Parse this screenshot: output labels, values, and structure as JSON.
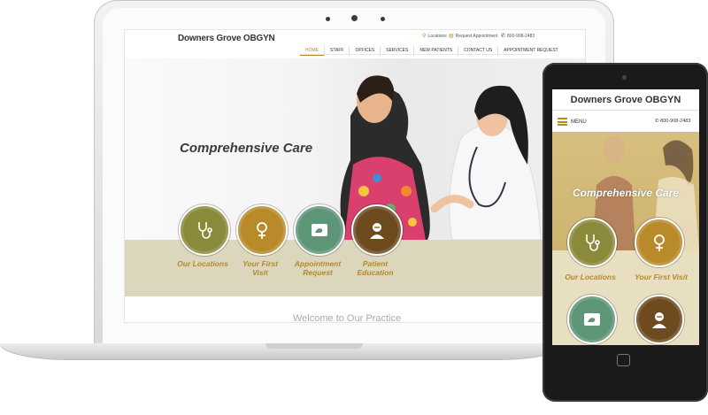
{
  "laptop": {
    "site_title": "Downers Grove OBGYN",
    "utility": {
      "locations": "Locations",
      "request": "Request Appointment",
      "phone": "800-908-2483"
    },
    "nav": [
      "HOME",
      "STAFF",
      "OFFICES",
      "SERVICES",
      "NEW PATIENTS",
      "CONTACT US",
      "APPOINTMENT REQUEST"
    ],
    "hero_heading": "Comprehensive Care",
    "quick_links": [
      {
        "label": "Our Locations",
        "icon": "stethoscope-icon",
        "color": "#8a8a3a"
      },
      {
        "label": "Your First Visit",
        "icon": "female-symbol-icon",
        "color": "#b88a2a"
      },
      {
        "label": "Appointment Request",
        "icon": "ultrasound-icon",
        "color": "#5e9576"
      },
      {
        "label": "Patient Education",
        "icon": "doctor-icon",
        "color": "#6d4b1f"
      }
    ],
    "faded_text": "Welcome to Our Practice"
  },
  "phone": {
    "site_title": "Downers Grove OBGYN",
    "menu_label": "MENU",
    "phone": "800-908-2483",
    "hero_heading": "Comprehensive Care",
    "quick_links": [
      {
        "label": "Our Locations",
        "icon": "stethoscope-icon",
        "color": "#8a8a3a"
      },
      {
        "label": "Your First Visit",
        "icon": "female-symbol-icon",
        "color": "#b88a2a"
      },
      {
        "label": "",
        "icon": "ultrasound-icon",
        "color": "#5e9576"
      },
      {
        "label": "",
        "icon": "doctor-icon",
        "color": "#6d4b1f"
      }
    ]
  }
}
